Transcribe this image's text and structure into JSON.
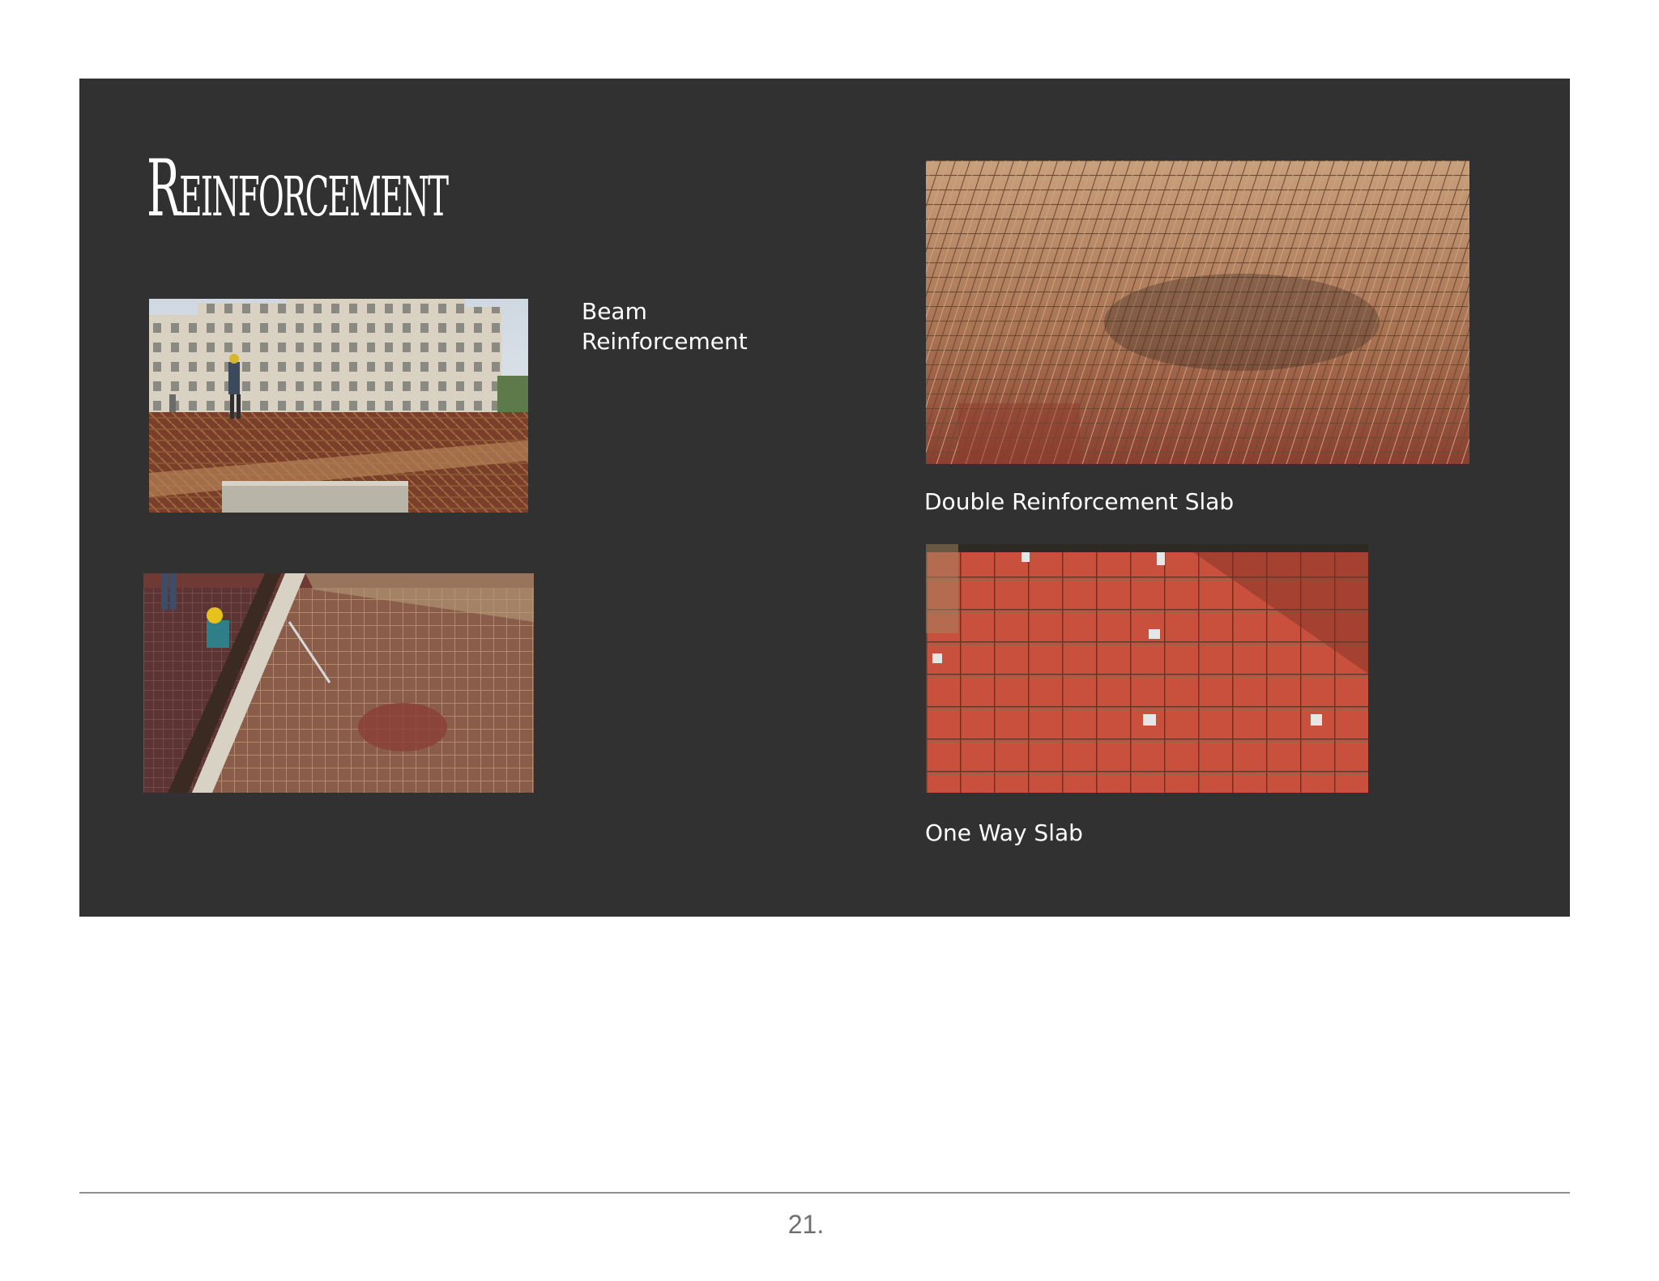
{
  "slide": {
    "title": "Reinforcement",
    "background_color": "#323132"
  },
  "captions": {
    "beam_line1": "Beam",
    "beam_line2": "Reinforcement",
    "double_slab": "Double Reinforcement Slab",
    "one_way_slab": "One Way Slab"
  },
  "footer": {
    "page_number": "21."
  }
}
